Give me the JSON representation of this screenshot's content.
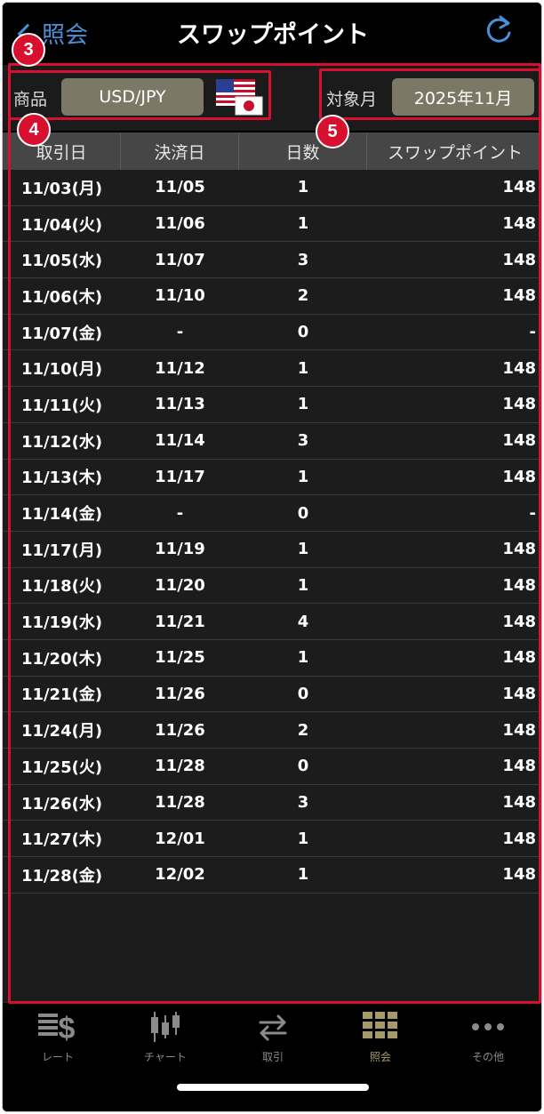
{
  "header": {
    "back_label": "照会",
    "title": "スワップポイント"
  },
  "selector": {
    "product_label": "商品",
    "product_value": "USD/JPY",
    "month_label": "対象月",
    "month_value": "2025年11月"
  },
  "annotations": {
    "badge_3": "3",
    "badge_4": "4",
    "badge_5": "5"
  },
  "table": {
    "columns": [
      "取引日",
      "決済日",
      "日数",
      "スワップポイント"
    ],
    "rows": [
      [
        "11/03(月)",
        "11/05",
        "1",
        "148"
      ],
      [
        "11/04(火)",
        "11/06",
        "1",
        "148"
      ],
      [
        "11/05(水)",
        "11/07",
        "3",
        "148"
      ],
      [
        "11/06(木)",
        "11/10",
        "2",
        "148"
      ],
      [
        "11/07(金)",
        "-",
        "0",
        "-"
      ],
      [
        "11/10(月)",
        "11/12",
        "1",
        "148"
      ],
      [
        "11/11(火)",
        "11/13",
        "1",
        "148"
      ],
      [
        "11/12(水)",
        "11/14",
        "3",
        "148"
      ],
      [
        "11/13(木)",
        "11/17",
        "1",
        "148"
      ],
      [
        "11/14(金)",
        "-",
        "0",
        "-"
      ],
      [
        "11/17(月)",
        "11/19",
        "1",
        "148"
      ],
      [
        "11/18(火)",
        "11/20",
        "1",
        "148"
      ],
      [
        "11/19(水)",
        "11/21",
        "4",
        "148"
      ],
      [
        "11/20(木)",
        "11/25",
        "1",
        "148"
      ],
      [
        "11/21(金)",
        "11/26",
        "0",
        "148"
      ],
      [
        "11/24(月)",
        "11/26",
        "2",
        "148"
      ],
      [
        "11/25(火)",
        "11/28",
        "0",
        "148"
      ],
      [
        "11/26(水)",
        "11/28",
        "3",
        "148"
      ],
      [
        "11/27(木)",
        "12/01",
        "1",
        "148"
      ],
      [
        "11/28(金)",
        "12/02",
        "1",
        "148"
      ]
    ]
  },
  "tabbar": {
    "items": [
      {
        "label": "レート",
        "icon": "rate-icon"
      },
      {
        "label": "チャート",
        "icon": "chart-icon"
      },
      {
        "label": "取引",
        "icon": "trade-icon"
      },
      {
        "label": "照会",
        "icon": "inquiry-icon",
        "active": true
      },
      {
        "label": "その他",
        "icon": "more-icon"
      }
    ]
  },
  "colors": {
    "accent": "#4a90d9",
    "annotation": "#d8102f",
    "button": "#7b7966",
    "active_tab": "#a79a6a"
  }
}
